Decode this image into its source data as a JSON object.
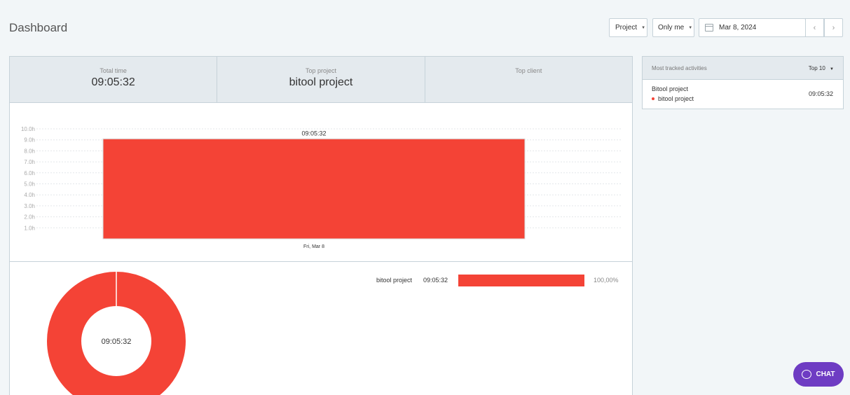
{
  "header": {
    "title": "Dashboard",
    "project_filter": "Project",
    "user_filter": "Only me",
    "date": "Mar 8, 2024",
    "prev_icon": "chevron-left-icon",
    "next_icon": "chevron-right-icon"
  },
  "stats": {
    "total_time_label": "Total time",
    "total_time_value": "09:05:32",
    "top_project_label": "Top project",
    "top_project_value": "bitool project",
    "top_client_label": "Top client",
    "top_client_value": ""
  },
  "chart_data": [
    {
      "type": "bar",
      "categories": [
        "Fri, Mar 8"
      ],
      "values": [
        9.09
      ],
      "value_labels": [
        "09:05:32"
      ],
      "ylabel": "",
      "ylim": [
        0,
        10
      ],
      "y_ticks": [
        "1.0h",
        "2.0h",
        "3.0h",
        "4.0h",
        "5.0h",
        "6.0h",
        "7.0h",
        "8.0h",
        "9.0h",
        "10.0h"
      ],
      "grid": true,
      "color": "#f44336"
    },
    {
      "type": "pie",
      "labels": [
        "bitool project"
      ],
      "values": [
        100
      ],
      "center_label": "09:05:32",
      "color": "#f44336"
    }
  ],
  "breakdown": {
    "name": "bitool project",
    "time": "09:05:32",
    "percent": "100,00%",
    "fraction": 1.0
  },
  "activities": {
    "title": "Most tracked activities",
    "top_label": "Top 10",
    "items": [
      {
        "title": "Bitool project",
        "project": "bitool project",
        "time": "09:05:32"
      }
    ]
  },
  "chat": {
    "label": "CHAT"
  },
  "colors": {
    "accent": "#f44336",
    "chat": "#6e3cc3"
  }
}
